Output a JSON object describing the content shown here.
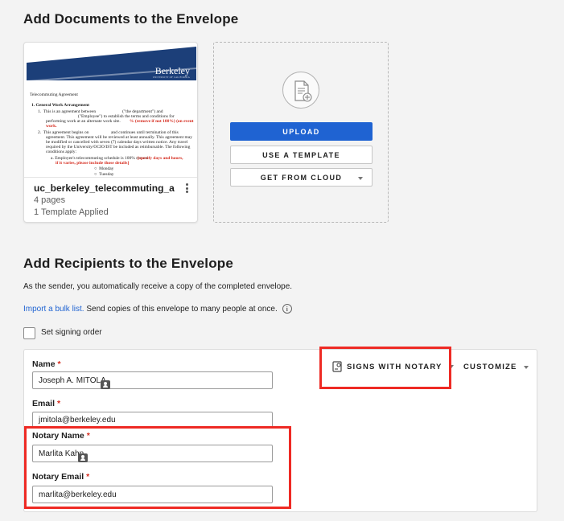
{
  "documents": {
    "heading": "Add Documents to the Envelope",
    "file": {
      "name": "uc_berkeley_telecommuting_ag...",
      "pages": "4 pages",
      "template": "1 Template Applied",
      "thumbnail": {
        "logo": "Berkeley",
        "logo_sub": "UNIVERSITY OF CALIFORNIA",
        "title": "Telecommuting Agreement",
        "section": "1.   General Work Arrangement",
        "item1a": "1.  This is an agreement between                        (\"the department\") and",
        "item1b": "                             (\"Employee\") to establish the terms and conditions for",
        "item1c": "performing work at an alternate work site.",
        "item1c_red": "% (remove if not 100%) (on event",
        "item1d": "work.",
        "item2a": "2.  This agreement begins on                    and continues until termination of this",
        "item2b": "agreement. This agreement will be reviewed at least annually.  This agreement may",
        "item2c": "be modified or cancelled with seven (7) calendar days written notice.  Any travel",
        "item2d": "required by the University/OCIO/IST be included as reimbursable. The following",
        "item2e": "conditions apply:",
        "item3a": "a.  Employee's telecommuting schedule is 100% remote",
        "item3a_red": "[specify days and hours,",
        "item3b_red": "if it varies, please include those details]",
        "day1": "Monday",
        "day2": "Tuesday"
      }
    },
    "upload_label": "UPLOAD",
    "template_label": "USE A TEMPLATE",
    "cloud_label": "GET FROM CLOUD"
  },
  "recipients": {
    "heading": "Add Recipients to the Envelope",
    "sender_note": "As the sender, you automatically receive a copy of the completed envelope.",
    "bulk_link": "Import a bulk list.",
    "bulk_text": " Send copies of this envelope to many people at once.",
    "info_glyph": "i",
    "signing_order_label": "Set signing order",
    "recipient": {
      "name_label": "Name",
      "name_value": "Joseph A. MITOLA",
      "email_label": "Email",
      "email_value": "jmitola@berkeley.edu",
      "notary_name_label": "Notary Name",
      "notary_name_value": "Marlita Kahn",
      "notary_email_label": "Notary Email",
      "notary_email_value": "marlita@berkeley.edu",
      "required_mark": "*",
      "action_label": "SIGNS WITH NOTARY",
      "customize_label": "CUSTOMIZE"
    }
  },
  "colors": {
    "primary": "#1f63d2",
    "highlight": "#ee2a24",
    "required": "#d52b1e",
    "berkeley_navy": "#1c3f79"
  }
}
